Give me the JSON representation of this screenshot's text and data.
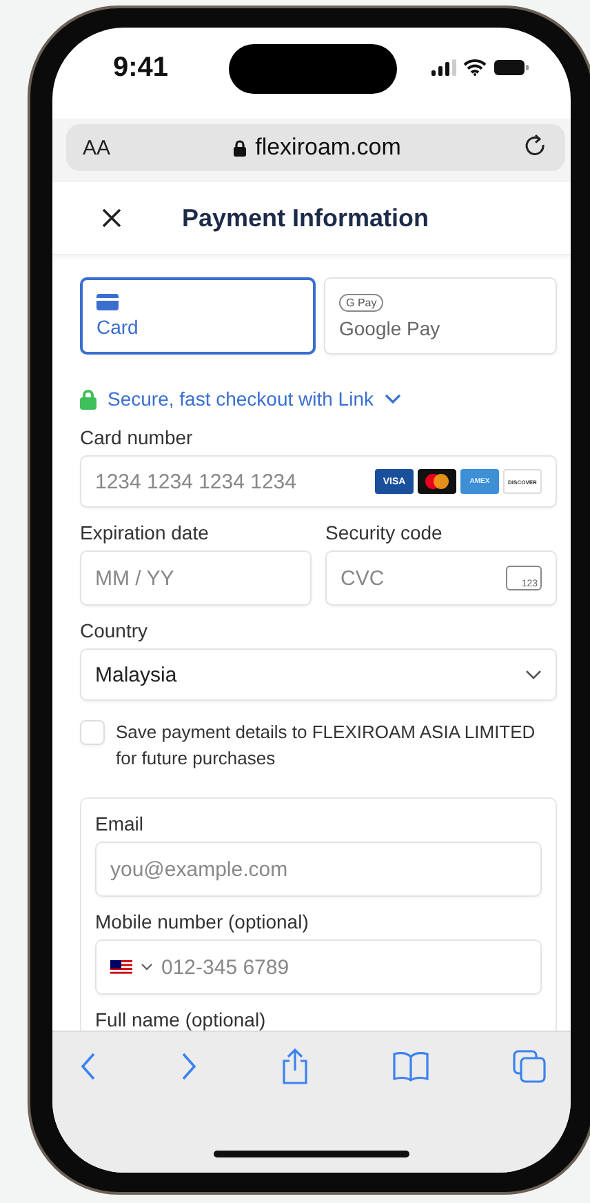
{
  "status_bar": {
    "time": "9:41"
  },
  "browser": {
    "text_size": "AA",
    "url": "flexiroam.com"
  },
  "header": {
    "title": "Payment Information"
  },
  "payment_methods": [
    {
      "kind": "card",
      "label": "Card",
      "selected": true
    },
    {
      "kind": "gpay",
      "badge": "G Pay",
      "label": "Google Pay",
      "selected": false
    }
  ],
  "link_checkout": "Secure, fast checkout with Link",
  "card_number": {
    "label": "Card number",
    "placeholder": "1234 1234 1234 1234",
    "brands": [
      "VISA",
      "AMEX",
      "DISCOVER"
    ]
  },
  "expiration": {
    "label": "Expiration date",
    "placeholder": "MM / YY"
  },
  "security_code": {
    "label": "Security code",
    "placeholder": "CVC",
    "icon_text": "123"
  },
  "country": {
    "label": "Country",
    "value": "Malaysia"
  },
  "save_details": {
    "label": "Save payment details to FLEXIROAM ASIA LIMITED for future purchases",
    "checked": false
  },
  "link_form": {
    "email": {
      "label": "Email",
      "placeholder": "you@example.com"
    },
    "mobile": {
      "label": "Mobile number (optional)",
      "placeholder": "012-345 6789"
    },
    "full_name": {
      "label": "Full name (optional)"
    }
  }
}
